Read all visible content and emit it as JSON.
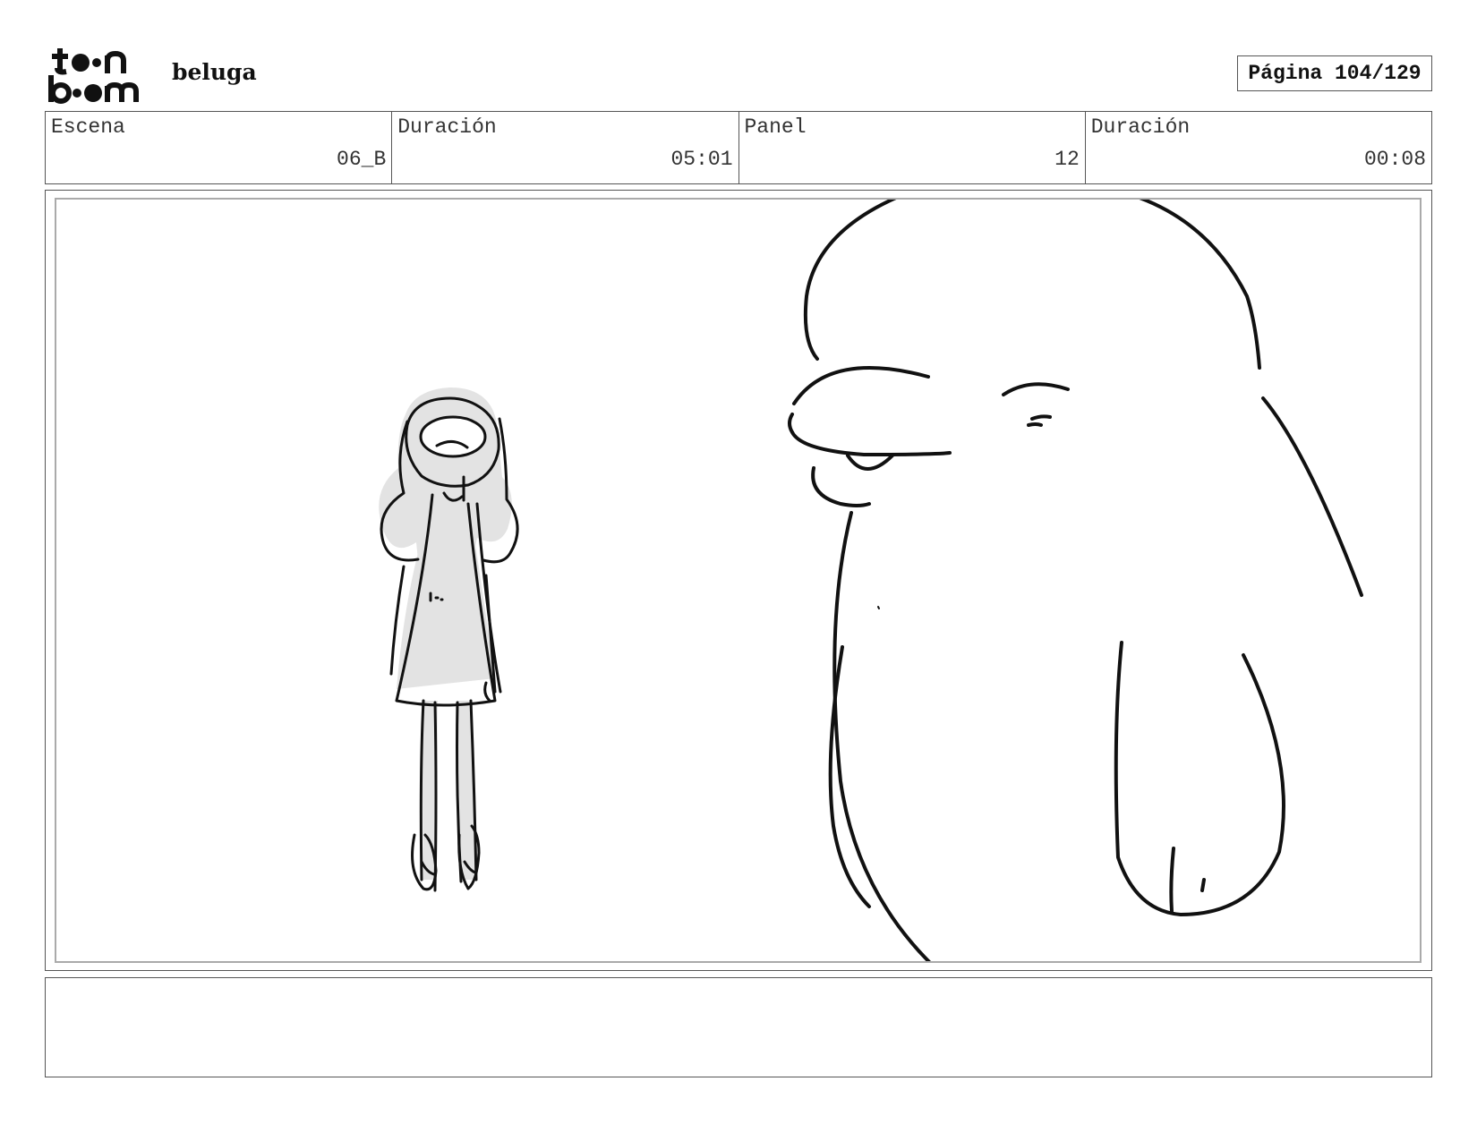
{
  "header": {
    "project": "beluga",
    "page_label": "Página 104/129"
  },
  "info": [
    {
      "label": "Escena",
      "value": "06_B"
    },
    {
      "label": "Duración",
      "value": "05:01"
    },
    {
      "label": "Panel",
      "value": "12"
    },
    {
      "label": "Duración",
      "value": "00:08"
    }
  ],
  "notes": "",
  "icons": {
    "logo": "toon-boom-logo"
  }
}
